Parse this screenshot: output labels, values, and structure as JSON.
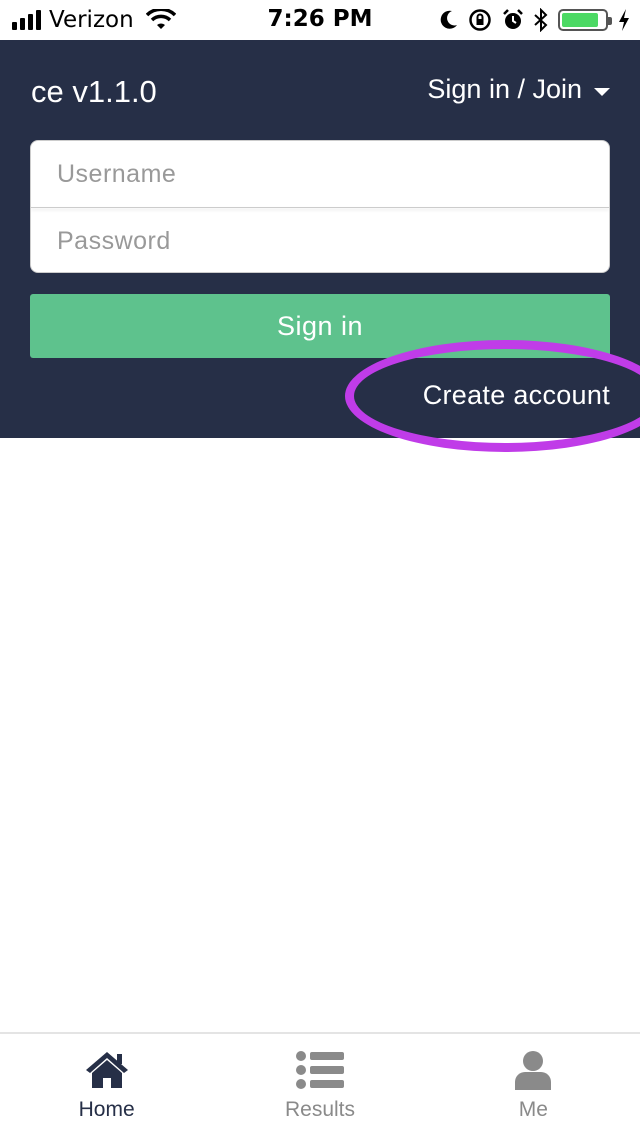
{
  "status_bar": {
    "carrier": "Verizon",
    "time": "7:26 PM",
    "icons": [
      "signal-icon",
      "wifi-icon",
      "moon-icon",
      "rotation-lock-icon",
      "alarm-icon",
      "bluetooth-icon",
      "battery-icon",
      "charging-icon"
    ],
    "battery_level": 0.85,
    "battery_color": "#4cd964"
  },
  "header": {
    "app_title": "ce v1.1.0",
    "account_menu_label": "Sign in / Join",
    "background_color": "#262f47"
  },
  "login_form": {
    "username_placeholder": "Username",
    "username_value": "",
    "password_placeholder": "Password",
    "password_value": "",
    "signin_label": "Sign in",
    "signin_color": "#5ec28d",
    "create_account_label": "Create account",
    "highlight_color": "#c03ce8"
  },
  "tab_bar": {
    "tabs": [
      {
        "label": "Home",
        "icon": "home-icon",
        "active": true
      },
      {
        "label": "Results",
        "icon": "list-icon",
        "active": false
      },
      {
        "label": "Me",
        "icon": "user-icon",
        "active": false
      }
    ],
    "active_color": "#262f47",
    "inactive_color": "#8a8a8a"
  }
}
